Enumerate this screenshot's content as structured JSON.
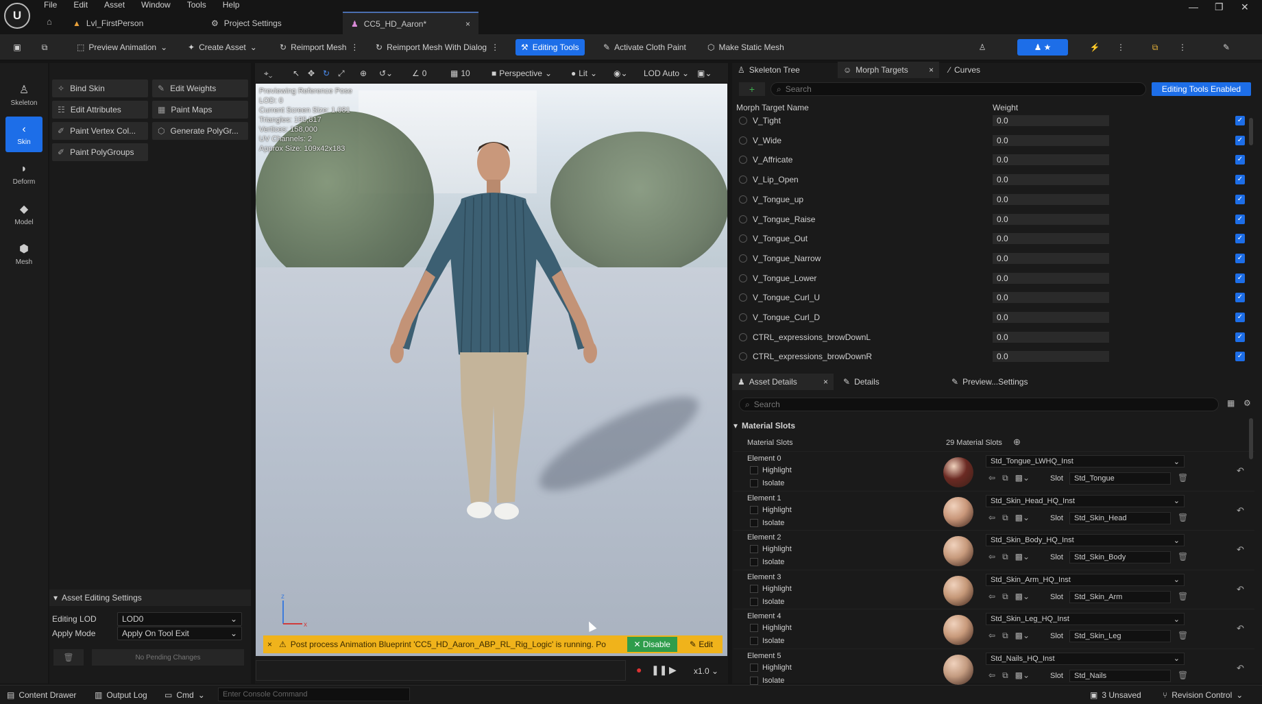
{
  "menu": [
    "File",
    "Edit",
    "Asset",
    "Window",
    "Tools",
    "Help"
  ],
  "tabs": [
    {
      "label": "Lvl_FirstPerson"
    },
    {
      "label": "Project Settings"
    },
    {
      "label": "CC5_HD_Aaron*"
    }
  ],
  "toolbar": {
    "preview_animation": "Preview Animation",
    "create_asset": "Create Asset",
    "reimport_mesh": "Reimport Mesh",
    "reimport_dialog": "Reimport Mesh With Dialog",
    "editing_tools": "Editing Tools",
    "activate_cloth": "Activate Cloth Paint",
    "make_static": "Make Static Mesh"
  },
  "rail": [
    "Skeleton",
    "Skin",
    "Deform",
    "Model",
    "Mesh"
  ],
  "tools": [
    "Bind Skin",
    "Edit Weights",
    "Edit Attributes",
    "Paint Maps",
    "Paint Vertex Col...",
    "Generate PolyGr...",
    "Paint PolyGroups"
  ],
  "asset_editing": {
    "header": "Asset Editing Settings",
    "editing_lod_label": "Editing LOD",
    "editing_lod_value": "LOD0",
    "apply_mode_label": "Apply Mode",
    "apply_mode_value": "Apply On Tool Exit",
    "pending": "No Pending Changes"
  },
  "viewport": {
    "view_mode": "Perspective",
    "lighting": "Lit",
    "lod": "LOD Auto",
    "grid_value": "10",
    "angle_value": "0",
    "stats": [
      "Previewing Reference Pose",
      "LOD: 0",
      "Current Screen Size: 1.081",
      "Triangles: 195,817",
      "Vertices: 158,000",
      "UV Channels: 2",
      "Approx Size: 109x42x183"
    ],
    "notice": "Post process Animation Blueprint 'CC5_HD_Aaron_ABP_RL_Rig_Logic' is running. Po",
    "disable": "Disable",
    "edit": "Edit",
    "speed": "x1.0"
  },
  "morph_panel": {
    "tabs": [
      "Skeleton Tree",
      "Morph Targets",
      "Curves"
    ],
    "search_placeholder": "Search",
    "editing_enabled": "Editing Tools Enabled",
    "col_name": "Morph Target Name",
    "col_weight": "Weight",
    "rows": [
      {
        "name": "V_Tight",
        "weight": "0.0"
      },
      {
        "name": "V_Wide",
        "weight": "0.0"
      },
      {
        "name": "V_Affricate",
        "weight": "0.0"
      },
      {
        "name": "V_Lip_Open",
        "weight": "0.0"
      },
      {
        "name": "V_Tongue_up",
        "weight": "0.0"
      },
      {
        "name": "V_Tongue_Raise",
        "weight": "0.0"
      },
      {
        "name": "V_Tongue_Out",
        "weight": "0.0"
      },
      {
        "name": "V_Tongue_Narrow",
        "weight": "0.0"
      },
      {
        "name": "V_Tongue_Lower",
        "weight": "0.0"
      },
      {
        "name": "V_Tongue_Curl_U",
        "weight": "0.0"
      },
      {
        "name": "V_Tongue_Curl_D",
        "weight": "0.0"
      },
      {
        "name": "CTRL_expressions_browDownL",
        "weight": "0.0"
      },
      {
        "name": "CTRL_expressions_browDownR",
        "weight": "0.0"
      }
    ]
  },
  "details_panel": {
    "tabs": [
      "Asset Details",
      "Details",
      "Preview...Settings"
    ],
    "search_placeholder": "Search",
    "section": "Material Slots",
    "slots_label": "Material Slots",
    "slots_count": "29 Material Slots",
    "highlight": "Highlight",
    "isolate": "Isolate",
    "slot_label": "Slot",
    "elements": [
      {
        "el": "Element 0",
        "material": "Std_Tongue_LWHQ_Inst",
        "slot": "Std_Tongue",
        "color": "#6b2a23"
      },
      {
        "el": "Element 1",
        "material": "Std_Skin_Head_HQ_Inst",
        "slot": "Std_Skin_Head",
        "color": "#c9977a"
      },
      {
        "el": "Element 2",
        "material": "Std_Skin_Body_HQ_Inst",
        "slot": "Std_Skin_Body",
        "color": "#c79a7c"
      },
      {
        "el": "Element 3",
        "material": "Std_Skin_Arm_HQ_Inst",
        "slot": "Std_Skin_Arm",
        "color": "#c59878"
      },
      {
        "el": "Element 4",
        "material": "Std_Skin_Leg_HQ_Inst",
        "slot": "Std_Skin_Leg",
        "color": "#c89a7b"
      },
      {
        "el": "Element 5",
        "material": "Std_Nails_HQ_Inst",
        "slot": "Std_Nails",
        "color": "#c39b80"
      }
    ]
  },
  "status": {
    "content_drawer": "Content Drawer",
    "output_log": "Output Log",
    "cmd": "Cmd",
    "console_placeholder": "Enter Console Command",
    "unsaved": "3 Unsaved",
    "revision": "Revision Control"
  },
  "colors": {
    "accent": "#1d6ee8",
    "notice": "#f0b31b",
    "disable": "#2f9d4b"
  }
}
